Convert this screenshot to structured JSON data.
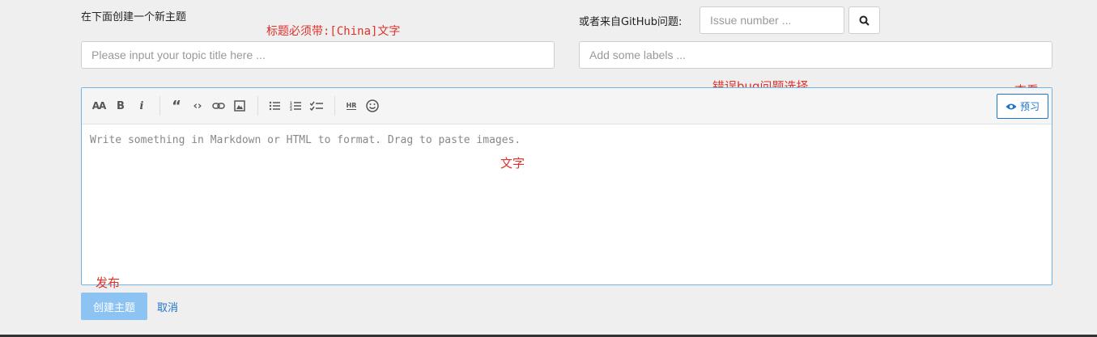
{
  "form": {
    "create_label": "在下面创建一个新主题",
    "github_label": "或者来自GitHub问题:",
    "issue_placeholder": "Issue number ...",
    "title_placeholder": "Please input your topic title here ...",
    "labels_placeholder": "Add some labels ..."
  },
  "annotations": {
    "title_note": "标题必须带:[China]文字",
    "bug_note": "错误bug问题选择",
    "view_note": "查看",
    "text_note": "文字",
    "publish_note": "发布"
  },
  "editor": {
    "toolbar_icons": [
      "font-size-icon",
      "bold-icon",
      "italic-icon",
      "quote-icon",
      "code-icon",
      "link-icon",
      "image-icon",
      "bullet-list-icon",
      "numbered-list-icon",
      "task-list-icon",
      "horizontal-rule-icon",
      "emoji-icon"
    ],
    "preview_label": "预习",
    "placeholder": "Write something in Markdown or HTML to format. Drag to paste images."
  },
  "actions": {
    "create_label": "创建主题",
    "cancel_label": "取消"
  },
  "colors": {
    "accent": "#1e74c9",
    "annotation": "#e0302a",
    "create_button": "#8cc3f3",
    "editor_border": "#6fb3e8"
  }
}
